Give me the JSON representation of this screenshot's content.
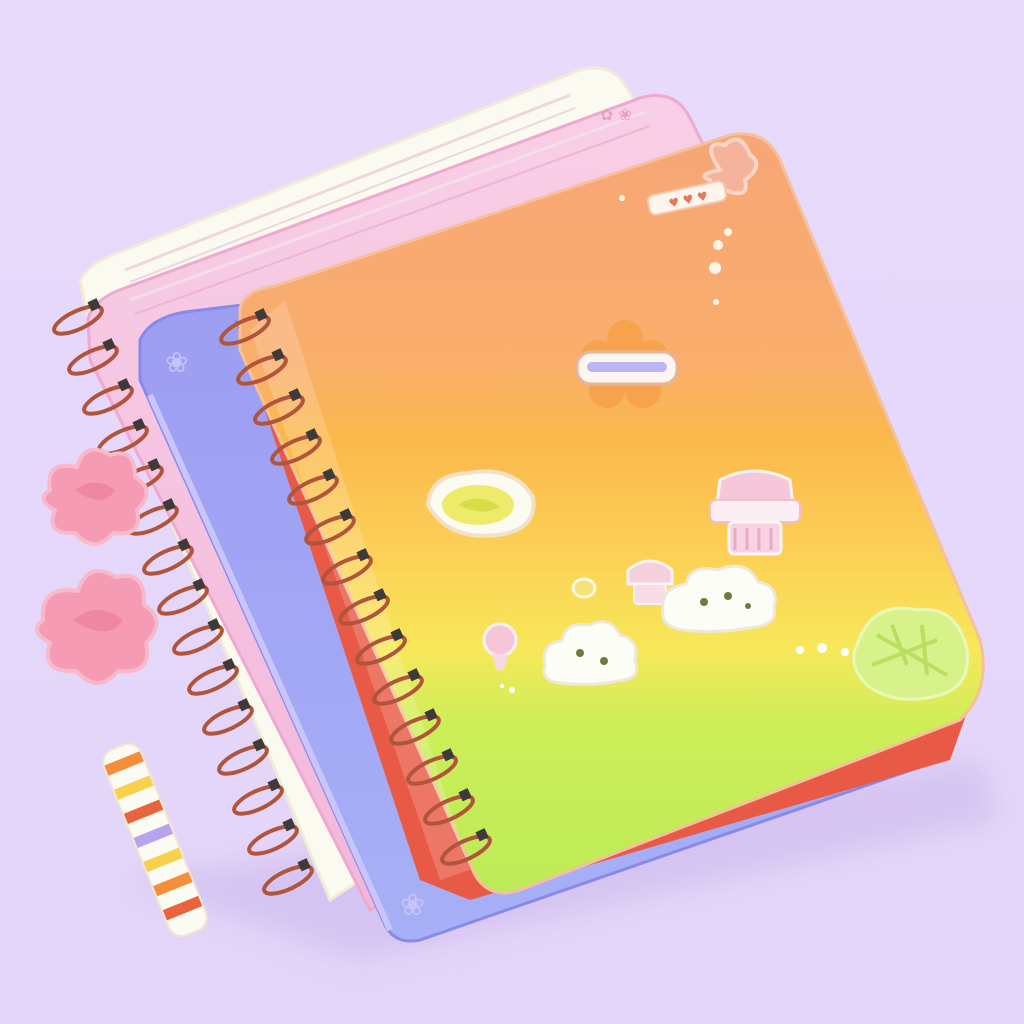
{
  "scene": {
    "background_color": "#E6D8FA",
    "subject": "stack-of-spiral-notebooks",
    "notebooks": [
      {
        "name": "back-white",
        "color": "#FBFAF2"
      },
      {
        "name": "pink",
        "color": "#F6C6E2"
      },
      {
        "name": "purple",
        "color": "#A9A7F4"
      },
      {
        "name": "rainbow-front",
        "colors": [
          "#F7A676",
          "#FBBB4A",
          "#FBE25C",
          "#C2EE5A"
        ]
      }
    ],
    "spiral_color": "#B0553C",
    "stickers": [
      "flower-sticker",
      "lemon-sticker",
      "cupcake-sticker",
      "cloud-stickers",
      "leaf-sticker",
      "butterfly-sticker"
    ],
    "side_objects": [
      "pink-flower-erasers",
      "striped-crayon"
    ]
  }
}
